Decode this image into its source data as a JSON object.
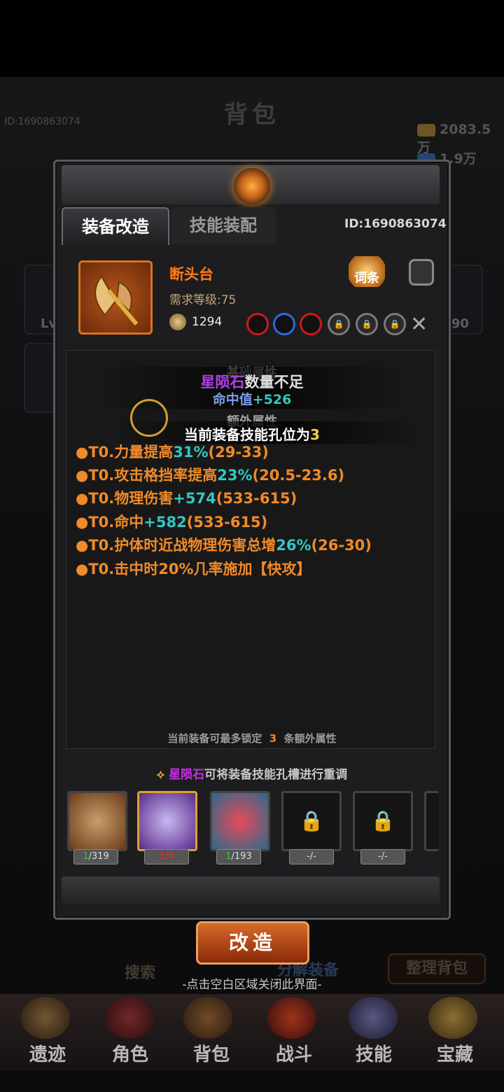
{
  "background": {
    "title": "背包",
    "player_id": "ID:1690863074",
    "gold": "2083.5万",
    "gems": "1.9万",
    "side_level_left": "Lv",
    "side_level_right": ".90",
    "search_label": "搜索",
    "decompose_label": "分解装备",
    "sort_label": "整理背包"
  },
  "dialog": {
    "tabs": [
      {
        "label": "装备改造",
        "active": true
      },
      {
        "label": "技能装配",
        "active": false
      }
    ],
    "id_text": "ID:1690863074",
    "item": {
      "name": "断头台",
      "name_color": "#ff7a1a",
      "required_level": "需求等级:75",
      "power": "1294",
      "sockets": [
        "red",
        "blue",
        "red",
        "locked",
        "locked",
        "locked"
      ]
    },
    "affix_button_label": "词条",
    "base_section_title": "基础属性",
    "base_attr": {
      "prefix": "命中值",
      "value": "+526"
    },
    "extra_section_title": "额外属性",
    "extra_attrs": [
      {
        "prefix": "●T0.力量提高",
        "value": "31%",
        "range": "(29-33)"
      },
      {
        "prefix": "●T0.攻击格挡率提高",
        "value": "23%",
        "range": "(20.5-23.6)"
      },
      {
        "prefix": "●T0.物理伤害",
        "value": "+574",
        "range": "(533-615)"
      },
      {
        "prefix": "●T0.命中",
        "value": "+582",
        "range": "(533-615)"
      },
      {
        "prefix": "●T0.护体时近战物理伤害总增",
        "value": "26%",
        "range": "(26-30)"
      },
      {
        "prefix": "●T0.击中时20%几率施加【快攻】",
        "value": "",
        "range": ""
      }
    ],
    "lock_note": {
      "before": "当前装备可最多锁定",
      "count": "3",
      "after": "条额外属性"
    },
    "hint": {
      "stone": "星陨石",
      "text": "可将装备技能孔槽进行重调"
    },
    "materials": [
      {
        "name": "orb-material",
        "have": "1",
        "need": "/319",
        "enough": true,
        "selected": false
      },
      {
        "name": "star-meteorite",
        "have": "1",
        "need": "/0",
        "enough": false,
        "selected": true
      },
      {
        "name": "gem-ore",
        "have": "1",
        "need": "/193",
        "enough": true,
        "selected": false
      },
      {
        "name": "locked-slot",
        "label": "-/-",
        "locked": true
      },
      {
        "name": "locked-slot",
        "label": "-/-",
        "locked": true
      }
    ],
    "reforge_button": "改造",
    "close_hint": "-点击空白区域关闭此界面-"
  },
  "toasts": {
    "stone_name": "星陨石",
    "stone_msg": "数量不足",
    "socket_msg": "当前装备技能孔位为",
    "socket_count": "3"
  },
  "nav": [
    {
      "label": "遗迹"
    },
    {
      "label": "角色"
    },
    {
      "label": "背包"
    },
    {
      "label": "战斗"
    },
    {
      "label": "技能"
    },
    {
      "label": "宝藏"
    }
  ]
}
